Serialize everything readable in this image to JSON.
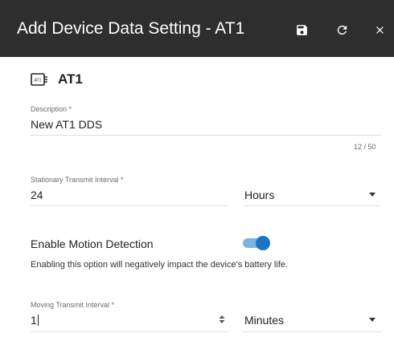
{
  "header": {
    "title": "Add Device Data Setting - AT1",
    "icons": [
      "save-icon",
      "refresh-icon",
      "close-icon"
    ]
  },
  "device": {
    "name": "AT1",
    "icon_text": "AT1"
  },
  "description": {
    "label": "Description *",
    "value": "New  AT1 DDS",
    "counter": "12 / 50"
  },
  "stationary": {
    "label": "Stationary Transmit Interval *",
    "value": "24",
    "unit": "Hours"
  },
  "motion": {
    "label": "Enable Motion Detection",
    "enabled": true,
    "note": "Enabling this option will negatively impact the device's battery life."
  },
  "moving": {
    "label": "Moving Transmit Interval *",
    "value": "1",
    "unit": "Minutes"
  },
  "colors": {
    "header_bg": "#2e2e2e",
    "toggle_accent": "#1d74c6"
  }
}
